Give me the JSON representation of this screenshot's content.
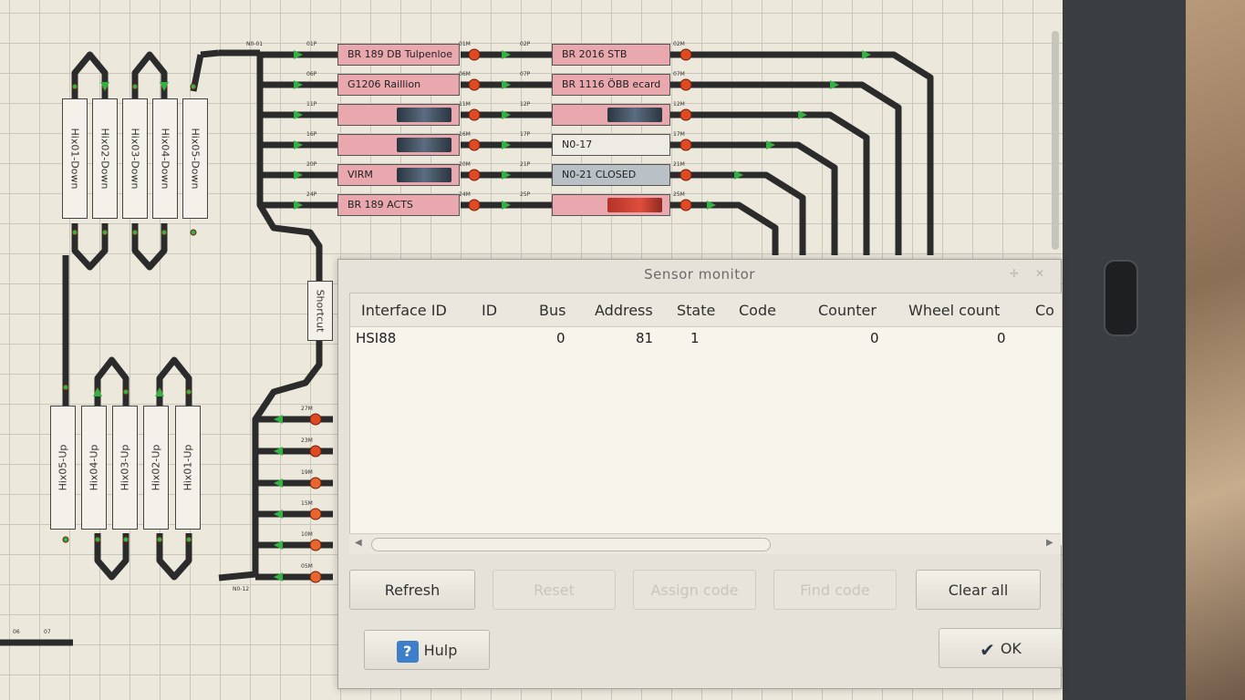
{
  "layout": {
    "trains_row1": [
      {
        "name": "BR 189 DB Tulpenloe",
        "type": "pink"
      },
      {
        "name": "BR 2016 STB",
        "type": "pink"
      }
    ],
    "trains": [
      {
        "left": "BR 189 DB Tulpenloe",
        "right": "BR 2016 STB"
      },
      {
        "left": "G1206  Raillion",
        "right": "BR 1116 ÖBB ecard"
      },
      {
        "left": "",
        "right": ""
      },
      {
        "left": "",
        "right": "N0-17"
      },
      {
        "left": "VIRM",
        "right": "N0-21 CLOSED"
      },
      {
        "left": "BR 189 ACTS",
        "right": ""
      }
    ],
    "blocks_down": [
      "Hix01-Down",
      "Hix02-Down",
      "Hix03-Down",
      "Hix04-Down",
      "Hix05-Down"
    ],
    "blocks_up": [
      "Hix05-Up",
      "Hix04-Up",
      "Hix03-Up",
      "Hix02-Up",
      "Hix01-Up"
    ],
    "shortcut": "Shortcut",
    "track_labels": {
      "n001": "N0-01",
      "n012": "N0-12",
      "s01P": "01P",
      "s02P": "02P",
      "s01M": "01M",
      "s02M": "02M",
      "s06P": "06P",
      "s07P": "07P",
      "s06M": "06M",
      "s07M": "07M",
      "s11P": "11P",
      "s12P": "12P",
      "s11M": "11M",
      "s12M": "12M",
      "s16P": "16P",
      "s17P": "17P",
      "s16M": "16M",
      "s17M": "17M",
      "s20P": "20P",
      "s21P": "21P",
      "s20M": "20M",
      "s21M": "21M",
      "s24P": "24P",
      "s25P": "25P",
      "s24M": "24M",
      "s25M": "25M",
      "s27M": "27M",
      "s23M": "23M",
      "s19M": "19M",
      "s15M": "15M",
      "s10M": "10M",
      "s05M": "05M",
      "b06": "06",
      "b07": "07"
    }
  },
  "dialog": {
    "title": "Sensor monitor",
    "columns": [
      "Interface ID",
      "ID",
      "Bus",
      "Address",
      "State",
      "Code",
      "Counter",
      "Wheel count",
      "Co"
    ],
    "rows": [
      {
        "interface_id": "HSI88",
        "id": "",
        "bus": "0",
        "address": "81",
        "state": "1",
        "code": "",
        "counter": "0",
        "wheel_count": "0"
      }
    ],
    "buttons": {
      "refresh": "Refresh",
      "reset": "Reset",
      "assign_code": "Assign code",
      "find_code": "Find code",
      "clear_all": "Clear all",
      "help": "Hulp",
      "ok": "OK"
    }
  },
  "colors": {
    "train_pink": "#e9a7ae",
    "signal_red": "#e04a22",
    "signal_green": "#35b043",
    "track": "#2b2b2b",
    "track_cyan": "#3fc1cf"
  }
}
